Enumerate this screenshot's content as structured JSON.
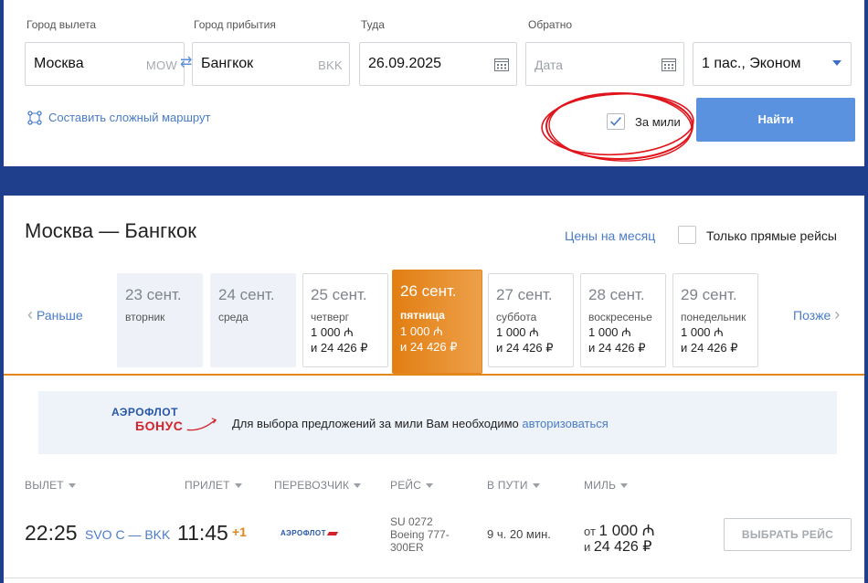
{
  "search": {
    "from_label": "Город вылета",
    "from_value": "Москва",
    "from_code": "MOW",
    "to_label": "Город прибытия",
    "to_value": "Бангкок",
    "to_code": "BKK",
    "depart_label": "Туда",
    "depart_value": "26.09.2025",
    "return_label": "Обратно",
    "return_placeholder": "Дата",
    "passengers_value": "1 пас., Эконом",
    "complex_route": "Составить сложный маршрут",
    "miles_label": "За мили",
    "miles_checked": true,
    "find_button": "Найти",
    "swap_icon": "⇄"
  },
  "results": {
    "title": "Москва — Бангкок",
    "month_prices": "Цены на месяц",
    "direct_only": "Только прямые рейсы",
    "prev": "Раньше",
    "next": "Позже",
    "days": [
      {
        "date": "23 сент.",
        "weekday": "вторник",
        "m1": "",
        "m2": ""
      },
      {
        "date": "24 сент.",
        "weekday": "среда",
        "m1": "",
        "m2": ""
      },
      {
        "date": "25 сент.",
        "weekday": "четверг",
        "m1": "1 000 ₼",
        "m2": "и 24 426 ₽"
      },
      {
        "date": "26 сент.",
        "weekday": "пятница",
        "m1": "1 000 ₼",
        "m2": "и 24 426 ₽"
      },
      {
        "date": "27 сент.",
        "weekday": "суббота",
        "m1": "1 000 ₼",
        "m2": "и 24 426 ₽"
      },
      {
        "date": "28 сент.",
        "weekday": "воскресенье",
        "m1": "1 000 ₼",
        "m2": "и 24 426 ₽"
      },
      {
        "date": "29 сент.",
        "weekday": "понедельник",
        "m1": "1 000 ₼",
        "m2": "и 24 426 ₽"
      }
    ],
    "bonus": {
      "logo_top": "АЭРОФЛОТ",
      "logo_bottom": "БОНУС",
      "text": "Для выбора предложений за мили Вам необходимо ",
      "link": "авторизоваться"
    },
    "columns": [
      "ВЫЛЕТ",
      "ПРИЛЕТ",
      "ПЕРЕВОЗЧИК",
      "РЕЙС",
      "В ПУТИ",
      "МИЛЬ"
    ],
    "flight": {
      "dep_time": "22:25",
      "route": "SVO C — BKK",
      "arr_time": "11:45",
      "arr_plus": "+1",
      "carrier": "АЭРОФЛОТ",
      "flight_no": "SU 0272",
      "aircraft_line1": "Boeing 777-",
      "aircraft_line2": "300ER",
      "duration": "9 ч. 20 мин.",
      "miles_prefix": "от ",
      "miles_value": "1 000 ₼",
      "rub_prefix": "и ",
      "rub_value": "24 426 ₽",
      "select_button": "ВЫБРАТЬ РЕЙС"
    }
  }
}
